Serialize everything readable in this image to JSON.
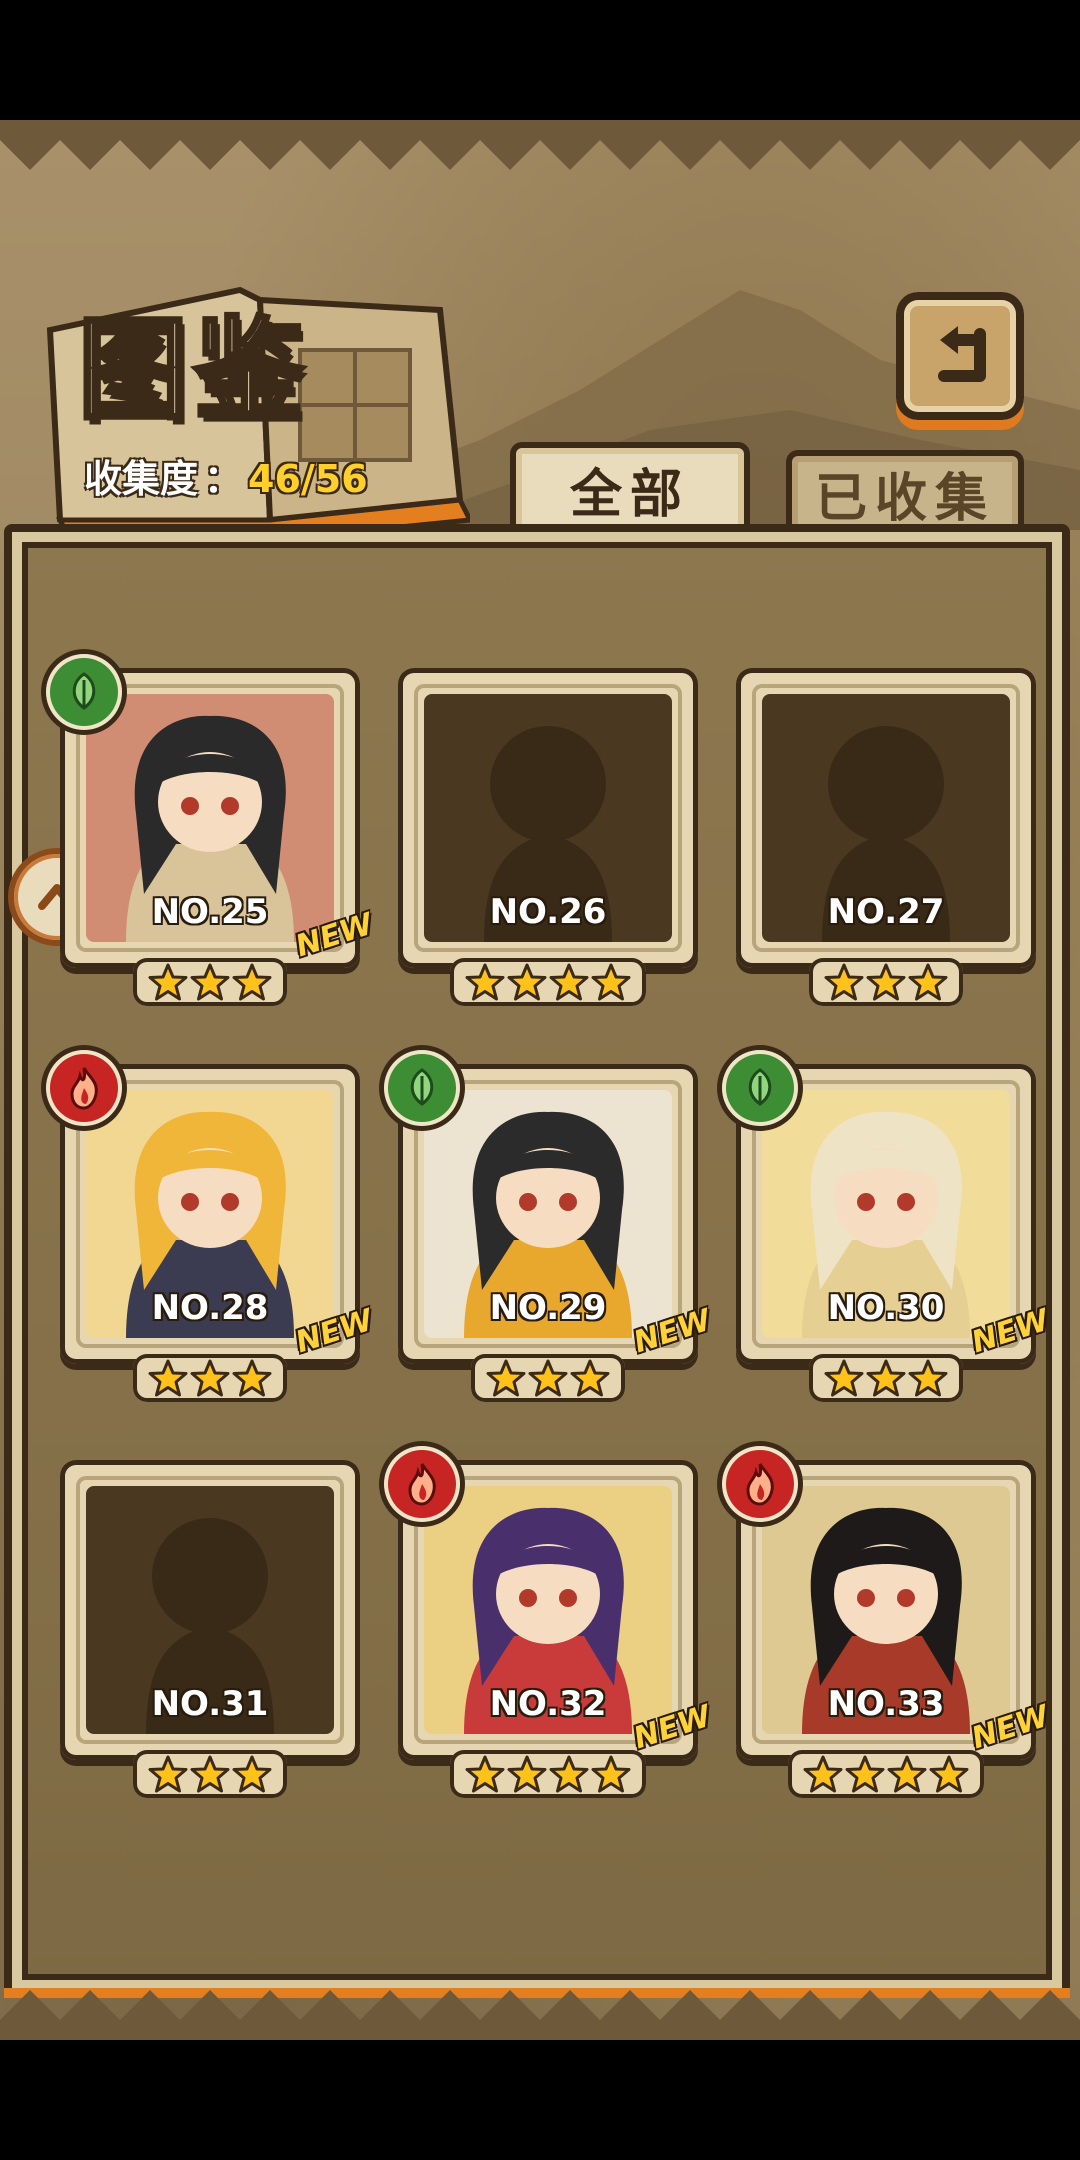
{
  "header": {
    "title": "图鉴",
    "collect_label": "收集度",
    "collect_sep": "：",
    "collect_value": "46/56"
  },
  "tabs": [
    {
      "label": "全部",
      "active": true
    },
    {
      "label": "已收集",
      "active": false
    }
  ],
  "icons": {
    "back": "return-arrow-icon",
    "side": "chevron-up-icon",
    "leaf": "leaf-element-icon",
    "fire": "fire-element-icon",
    "star": "star-icon"
  },
  "colors": {
    "accent": "#e37f1f",
    "star": "#ffc21a",
    "leaf": "#3c8d34",
    "fire": "#c72424",
    "collect_value": "#ffcf2b",
    "new": "#ffd23a"
  },
  "cards": [
    {
      "no": "NO.25",
      "stars": 3,
      "element": "leaf",
      "locked": false,
      "new": "NEW",
      "palette": [
        "#2a2a2a",
        "#d9c49a",
        "#b83226"
      ]
    },
    {
      "no": "NO.26",
      "stars": 4,
      "element": null,
      "locked": true,
      "new": null
    },
    {
      "no": "NO.27",
      "stars": 3,
      "element": null,
      "locked": true,
      "new": null
    },
    {
      "no": "NO.28",
      "stars": 3,
      "element": "fire",
      "locked": false,
      "new": "NEW",
      "palette": [
        "#f0b63a",
        "#3b3b52",
        "#ffd86b"
      ]
    },
    {
      "no": "NO.29",
      "stars": 3,
      "element": "leaf",
      "locked": false,
      "new": "NEW",
      "palette": [
        "#2b2b2b",
        "#e8a82d",
        "#f4f4f4"
      ]
    },
    {
      "no": "NO.30",
      "stars": 3,
      "element": "leaf",
      "locked": false,
      "new": "NEW",
      "palette": [
        "#efe3c6",
        "#e5cf92",
        "#ffe27a"
      ]
    },
    {
      "no": "NO.31",
      "stars": 3,
      "element": null,
      "locked": true,
      "new": null
    },
    {
      "no": "NO.32",
      "stars": 4,
      "element": "fire",
      "locked": false,
      "new": "NEW",
      "palette": [
        "#4a2f6d",
        "#c93a3a",
        "#f2c64a"
      ]
    },
    {
      "no": "NO.33",
      "stars": 4,
      "element": "fire",
      "locked": false,
      "new": "NEW",
      "palette": [
        "#1f1a1a",
        "#a83a2a",
        "#d8b86a"
      ]
    }
  ]
}
